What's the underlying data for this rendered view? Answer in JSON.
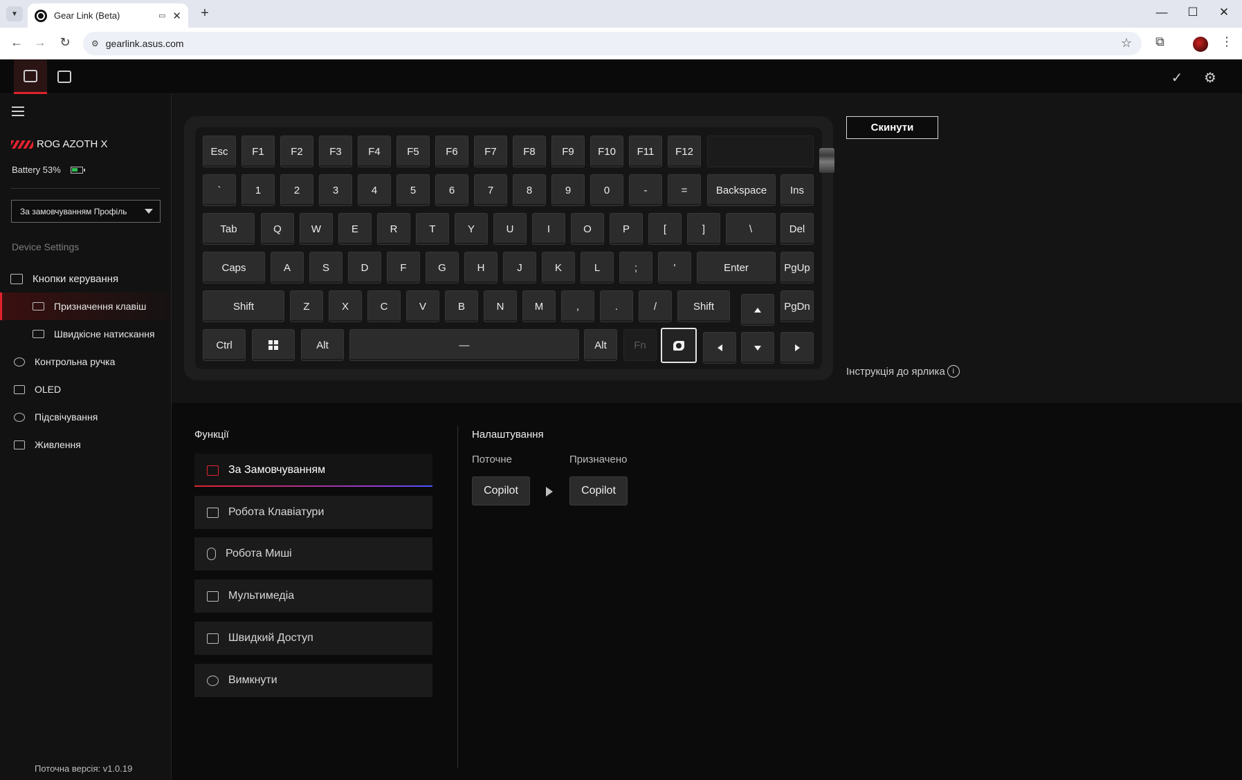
{
  "browser": {
    "tab_title": "Gear Link (Beta)",
    "url": "gearlink.asus.com",
    "new_tab": "+",
    "minimize": "—",
    "maximize": "☐",
    "close": "✕"
  },
  "sidebar": {
    "device_name": "ROG AZOTH X",
    "battery_label": "Battery 53%",
    "battery_percent": 53,
    "profile": "За замовчуванням Профіль",
    "section_title": "Device Settings",
    "items": [
      {
        "label": "Кнопки керування",
        "icon": "fn-key-icon"
      },
      {
        "label": "Призначення клавіш",
        "icon": "keyboard-icon"
      },
      {
        "label": "Швидкісне натискання",
        "icon": "rapid-trigger-icon"
      },
      {
        "label": "Контрольна ручка",
        "icon": "knob-icon"
      },
      {
        "label": "OLED",
        "icon": "oled-icon"
      },
      {
        "label": "Підсвічування",
        "icon": "lighting-icon"
      },
      {
        "label": "Живлення",
        "icon": "battery-icon"
      }
    ],
    "version": "Поточна версія: v1.0.19"
  },
  "keyboard": {
    "row1": [
      "Esc",
      "F1",
      "F2",
      "F3",
      "F4",
      "F5",
      "F6",
      "F7",
      "F8",
      "F9",
      "F10",
      "F11",
      "F12"
    ],
    "row2": [
      "`",
      "1",
      "2",
      "3",
      "4",
      "5",
      "6",
      "7",
      "8",
      "9",
      "0",
      "-",
      "=",
      "Backspace",
      "Ins"
    ],
    "row3": [
      "Tab",
      "Q",
      "W",
      "E",
      "R",
      "T",
      "Y",
      "U",
      "I",
      "O",
      "P",
      "[",
      "]",
      "\\",
      "Del"
    ],
    "row4": [
      "Caps",
      "A",
      "S",
      "D",
      "F",
      "G",
      "H",
      "J",
      "K",
      "L",
      ";",
      "'",
      "Enter",
      "PgUp"
    ],
    "row5": [
      "Shift",
      "Z",
      "X",
      "C",
      "V",
      "B",
      "N",
      "M",
      ",",
      ".",
      "/",
      "Shift",
      "PgDn"
    ],
    "row6": [
      "Ctrl",
      "Alt",
      "—",
      "Alt",
      "Fn"
    ]
  },
  "reset_label": "Скинути",
  "guide_label": "Інструкція до ярлика",
  "functions": {
    "title": "Функції",
    "items": [
      {
        "label": "За Замовчуванням",
        "icon": "default-icon"
      },
      {
        "label": "Робота Клавіатури",
        "icon": "keyboard-icon"
      },
      {
        "label": "Робота Миші",
        "icon": "mouse-icon"
      },
      {
        "label": "Мультимедіа",
        "icon": "multimedia-icon"
      },
      {
        "label": "Швидкий Доступ",
        "icon": "shortcut-icon"
      },
      {
        "label": "Вимкнути",
        "icon": "disable-icon"
      }
    ]
  },
  "settings": {
    "title": "Налаштування",
    "current_label": "Поточне",
    "assigned_label": "Призначено",
    "current_value": "Copilot",
    "assigned_value": "Copilot"
  },
  "colors": {
    "accent": "#e1232e",
    "battery": "#2ec04f"
  }
}
